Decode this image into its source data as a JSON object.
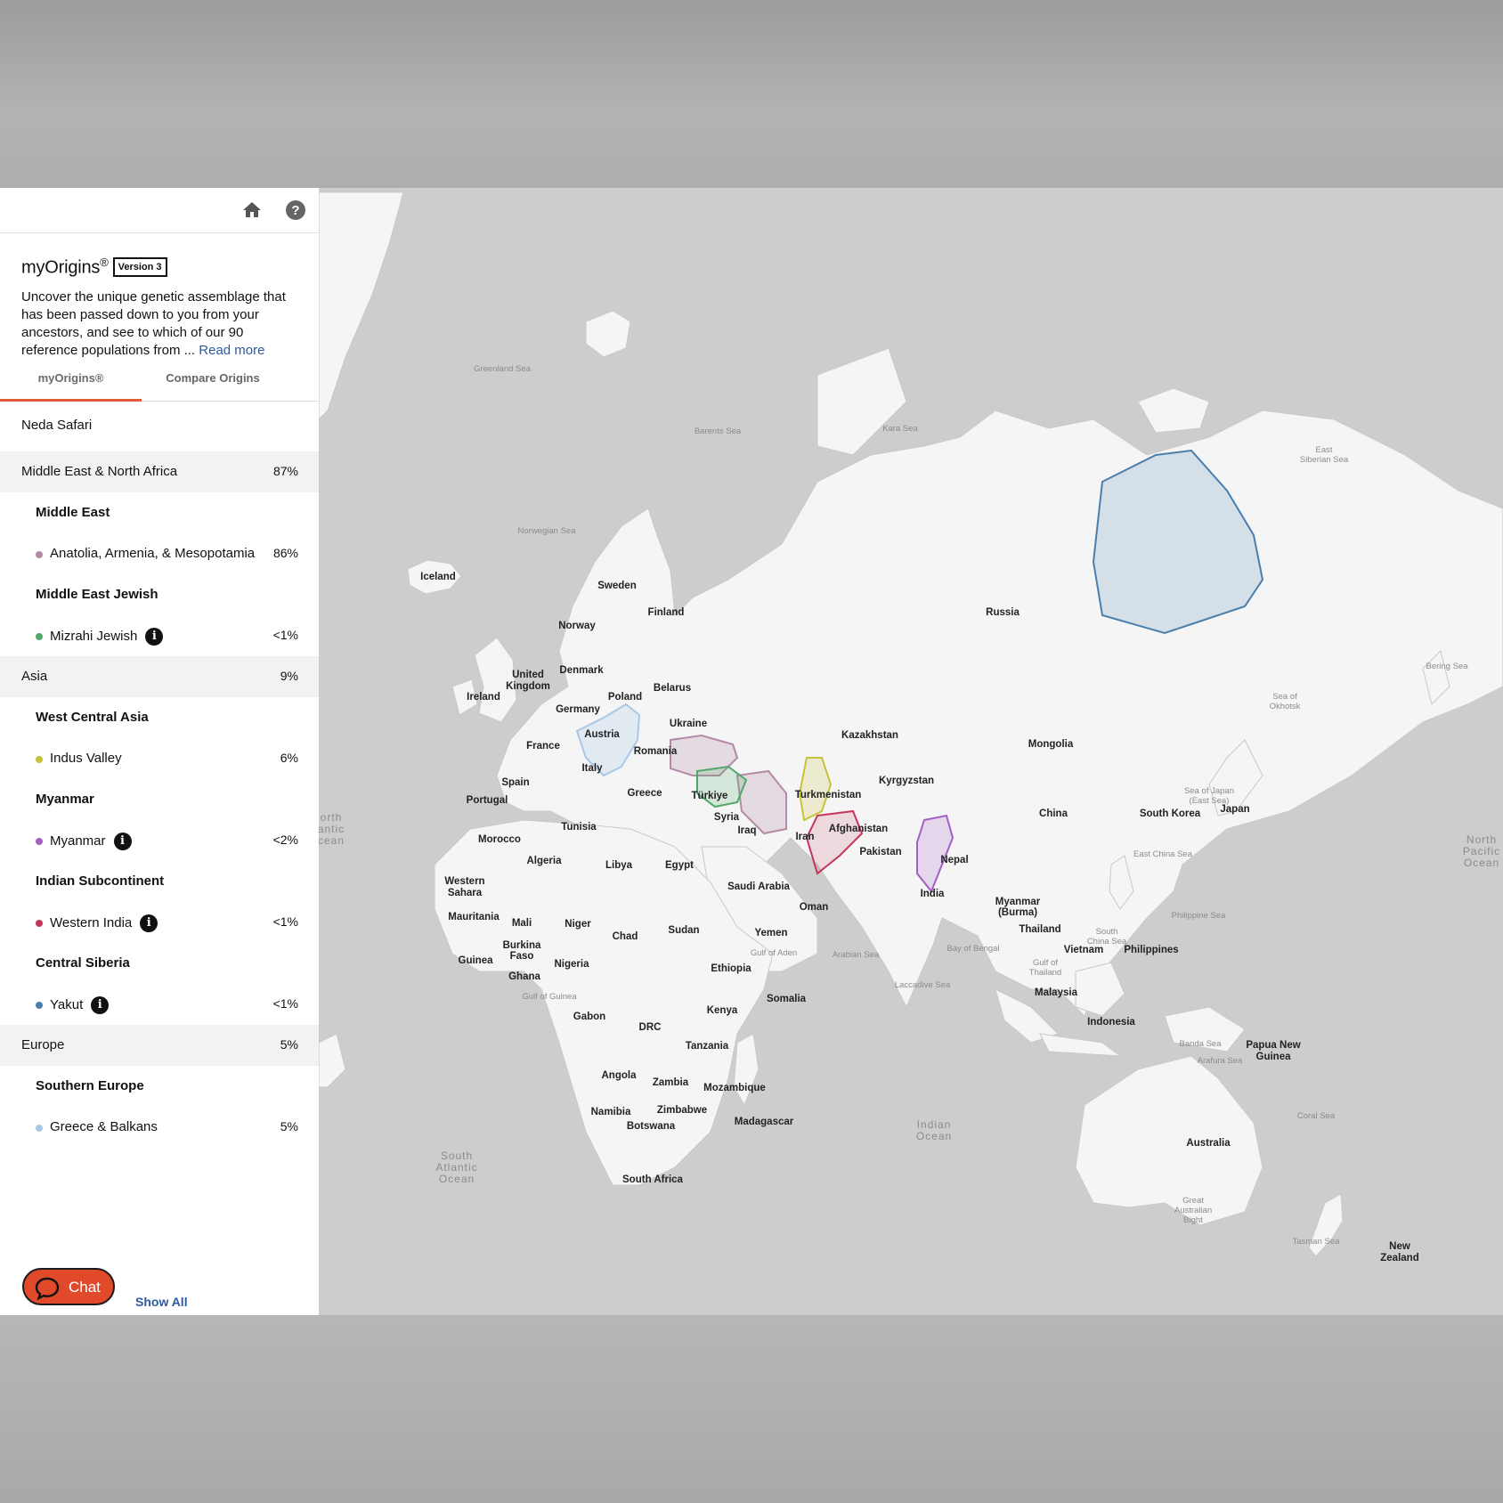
{
  "header": {
    "brand": "myOrigins",
    "brand_sup": "®",
    "version": "Version 3",
    "description": "Uncover the unique genetic assemblage that has been passed down to you from your ancestors, and see to which of our 90 reference populations from ...",
    "read_more": "Read more"
  },
  "tabs": [
    {
      "label": "myOrigins®",
      "active": true
    },
    {
      "label": "Compare Origins",
      "active": false
    }
  ],
  "user": "Neda Safari",
  "origins": {
    "mena": {
      "label": "Middle East & North Africa",
      "pct": "87%"
    },
    "middle_east": {
      "label": "Middle East"
    },
    "anatolia": {
      "label": "Anatolia, Armenia, & Mesopotamia",
      "pct": "86%",
      "color": "#b48aa6"
    },
    "me_jewish": {
      "label": "Middle East Jewish"
    },
    "mizrahi": {
      "label": "Mizrahi Jewish",
      "pct": "<1%",
      "color": "#4fa86a"
    },
    "asia": {
      "label": "Asia",
      "pct": "9%"
    },
    "wca": {
      "label": "West Central Asia"
    },
    "indus": {
      "label": "Indus Valley",
      "pct": "6%",
      "color": "#c9c236"
    },
    "myanmar_sub": {
      "label": "Myanmar"
    },
    "myanmar": {
      "label": "Myanmar",
      "pct": "<2%",
      "color": "#a35fc4"
    },
    "indian_sub": {
      "label": "Indian Subcontinent"
    },
    "western_india": {
      "label": "Western India",
      "pct": "<1%",
      "color": "#c4365a"
    },
    "central_siberia": {
      "label": "Central Siberia"
    },
    "yakut": {
      "label": "Yakut",
      "pct": "<1%",
      "color": "#4a7fad"
    },
    "europe": {
      "label": "Europe",
      "pct": "5%"
    },
    "southern_europe": {
      "label": "Southern Europe"
    },
    "greece": {
      "label": "Greece & Balkans",
      "pct": "5%",
      "color": "#a9c8e8"
    }
  },
  "footer": {
    "chat": "Chat",
    "show_all": "Show All"
  },
  "map": {
    "countries": {
      "iceland": "Iceland",
      "sweden": "Sweden",
      "finland": "Finland",
      "norway": "Norway",
      "russia": "Russia",
      "united_kingdom_1": "United",
      "united_kingdom_2": "Kingdom",
      "denmark": "Denmark",
      "ireland": "Ireland",
      "belarus": "Belarus",
      "poland": "Poland",
      "germany": "Germany",
      "ukraine": "Ukraine",
      "france": "France",
      "austria": "Austria",
      "romania": "Romania",
      "kazakhstan": "Kazakhstan",
      "mongolia": "Mongolia",
      "italy": "Italy",
      "spain": "Spain",
      "portugal": "Portugal",
      "greece": "Greece",
      "turkiye": "Türkiye",
      "turkmenistan": "Turkmenistan",
      "kyrgyzstan": "Kyrgyzstan",
      "china": "China",
      "south_korea": "South Korea",
      "japan": "Japan",
      "tunisia": "Tunisia",
      "syria": "Syria",
      "iraq": "Iraq",
      "iran": "Iran",
      "afghanistan": "Afghanistan",
      "morocco": "Morocco",
      "pakistan": "Pakistan",
      "nepal": "Nepal",
      "algeria": "Algeria",
      "libya": "Libya",
      "egypt": "Egypt",
      "western_sahara_1": "Western",
      "western_sahara_2": "Sahara",
      "saudi_arabia": "Saudi Arabia",
      "india": "India",
      "myanmar_1": "Myanmar",
      "myanmar_2": "(Burma)",
      "oman": "Oman",
      "mauritania": "Mauritania",
      "mali": "Mali",
      "niger": "Niger",
      "sudan": "Sudan",
      "chad": "Chad",
      "yemen": "Yemen",
      "thailand": "Thailand",
      "vietnam": "Vietnam",
      "philippines": "Philippines",
      "burkina_1": "Burkina",
      "burkina_2": "Faso",
      "guinea": "Guinea",
      "nigeria": "Nigeria",
      "ghana": "Ghana",
      "ethiopia": "Ethiopia",
      "malaysia": "Malaysia",
      "somalia": "Somalia",
      "kenya": "Kenya",
      "gabon": "Gabon",
      "drc": "DRC",
      "indonesia": "Indonesia",
      "png_1": "Papua New",
      "png_2": "Guinea",
      "tanzania": "Tanzania",
      "angola": "Angola",
      "zambia": "Zambia",
      "mozambique": "Mozambique",
      "namibia": "Namibia",
      "zimbabwe": "Zimbabwe",
      "botswana": "Botswana",
      "madagascar": "Madagascar",
      "australia": "Australia",
      "south_africa": "South Africa",
      "new_zealand_1": "New",
      "new_zealand_2": "Zealand"
    },
    "seas": {
      "greenland_sea": "Greenland Sea",
      "barents_sea": "Barents Sea",
      "kara_sea": "Kara Sea",
      "east_siberian_1": "East",
      "east_siberian_2": "Siberian Sea",
      "norwegian_sea": "Norwegian Sea",
      "bering_sea": "Bering Sea",
      "okhotsk_1": "Sea of",
      "okhotsk_2": "Okhotsk",
      "japan_sea_1": "Sea of Japan",
      "japan_sea_2": "(East Sea)",
      "east_china_sea": "East China Sea",
      "philippine_sea": "Philippine Sea",
      "south_china_1": "South",
      "south_china_2": "China Sea",
      "gulf_aden": "Gulf of Aden",
      "arabian_sea": "Arabian Sea",
      "bay_bengal": "Bay of Bengal",
      "gulf_thailand_1": "Gulf of",
      "gulf_thailand_2": "Thailand",
      "laccadive_sea": "Laccadive Sea",
      "gulf_guinea": "Gulf of Guinea",
      "banda_sea": "Banda Sea",
      "arafura_sea": "Arafura Sea",
      "coral_sea": "Coral Sea",
      "great_bight_1": "Great",
      "great_bight_2": "Australian",
      "great_bight_3": "Bight",
      "tasman_sea": "Tasman Sea"
    },
    "oceans": {
      "n_atlantic_1": "orth",
      "n_atlantic_2": "antic",
      "n_atlantic_3": "cean",
      "n_pacific_1": "North",
      "n_pacific_2": "Pacific",
      "n_pacific_3": "Ocean",
      "s_atlantic_1": "South",
      "s_atlantic_2": "Atlantic",
      "s_atlantic_3": "Ocean",
      "indian_1": "Indian",
      "indian_2": "Ocean"
    }
  }
}
